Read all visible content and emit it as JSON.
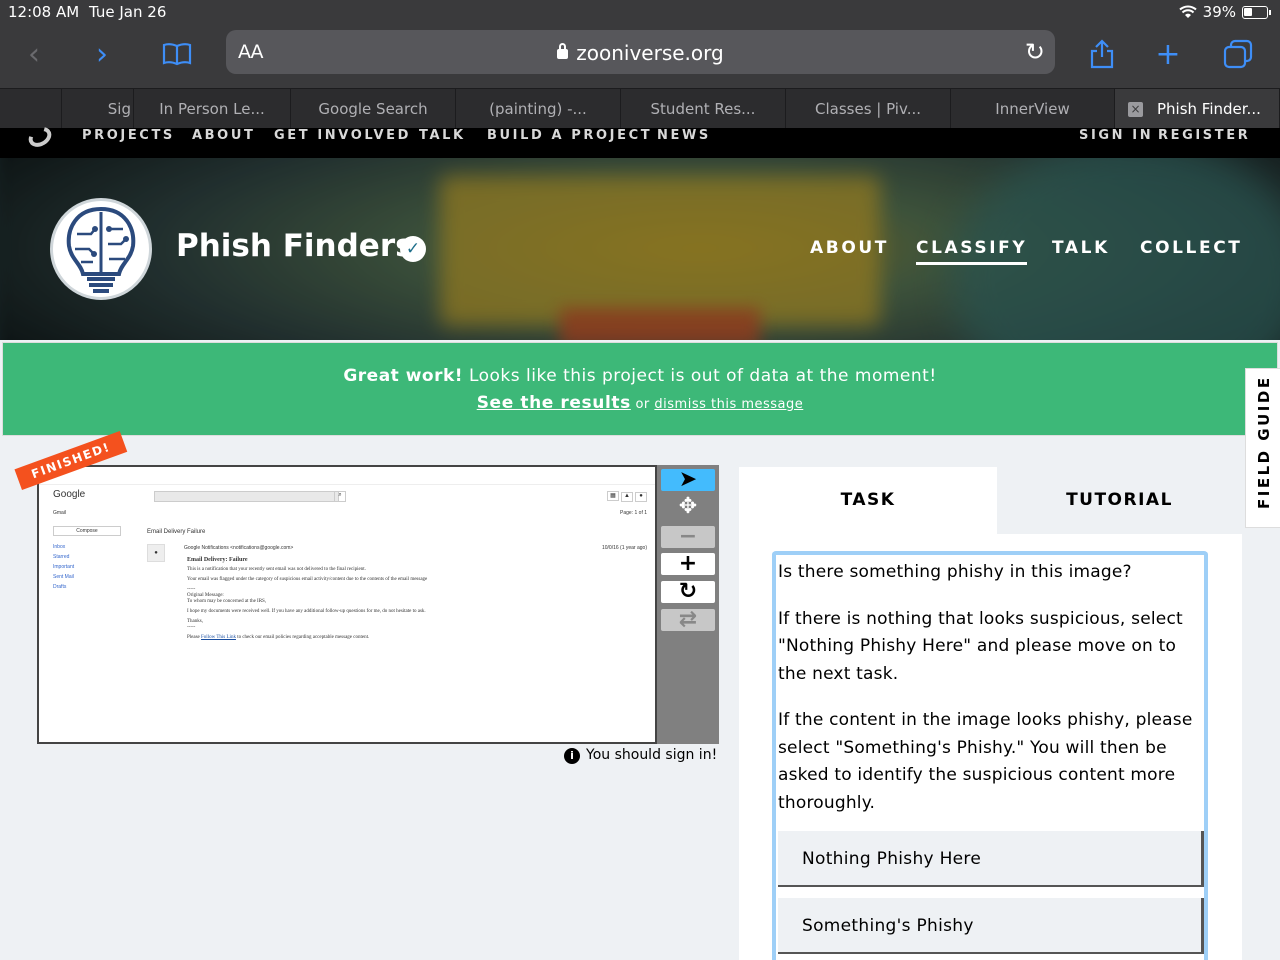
{
  "statusbar": {
    "time": "12:08 AM",
    "date": "Tue Jan 26",
    "battery": "39%"
  },
  "browser": {
    "aa_label": "AA",
    "url": "zooniverse.org",
    "tabs": [
      "Sig",
      "In Person Le...",
      "Google Search",
      "(painting) -...",
      "Student Res...",
      "Classes | Piv...",
      "InnerView",
      "Phish Finder..."
    ]
  },
  "site_nav": {
    "left": [
      "PROJECTS",
      "ABOUT",
      "GET INVOLVED",
      "TALK",
      "BUILD A PROJECT",
      "NEWS"
    ],
    "sign_in": "SIGN IN",
    "register": "REGISTER"
  },
  "project": {
    "title": "Phish Finders",
    "nav": [
      "ABOUT",
      "CLASSIFY",
      "TALK",
      "COLLECT"
    ],
    "active_nav": "CLASSIFY"
  },
  "banner": {
    "bold": "Great work!",
    "message": " Looks like this project is out of data at the moment!",
    "results_link": "See the results",
    "or": " or ",
    "dismiss_link": "dismiss this message"
  },
  "field_guide": "FIELD GUIDE",
  "subject": {
    "ribbon": "FINISHED!",
    "email": {
      "logo": "Google",
      "gmail": "Gmail",
      "pager": "Page: 1 of 1",
      "compose": "Compose",
      "folders": [
        "Inbox",
        "Starred",
        "Important",
        "Sent Mail",
        "Drafts"
      ],
      "subject_line": "Email Delivery Failure",
      "from": "Google Notifications <notifications@google.com>",
      "date": "10/0/16 (1 year ago)",
      "heading": "Email Delivery: Failure",
      "p1": "This is a notification that your recently sent email was not delivered to the final recipient.",
      "p2": "Your email was flagged under the category of suspicious email activity/content due to the contents of the email message",
      "p3a": "-----",
      "p3b": "Original Message:",
      "p3c": "To whom may be concerned at the IRS,",
      "p4": "I hope my documents were received well. If you have any additional follow-up questions for me, do not hesitate to ask.",
      "p5a": "Thanks,",
      "p5b": "-----",
      "p6a": "Please ",
      "p6link": "Follow This Link",
      "p6b": " to check our email policies regarding acceptable message content."
    },
    "sign_in_note": "You should sign in!"
  },
  "task_panel": {
    "tabs": [
      "TASK",
      "TUTORIAL"
    ],
    "active_tab": "TASK",
    "question": [
      "Is there something phishy in this image?",
      "If there is nothing that looks suspicious, select \"Nothing Phishy Here\" and please move on to the next task.",
      "If the content in the image looks phishy, please select \"Something's Phishy.\" You will then be asked to identify the suspicious content more thoroughly."
    ],
    "answers": [
      "Nothing Phishy Here",
      "Something's Phishy"
    ]
  },
  "colors": {
    "banner_green": "#3db878",
    "active_tool_blue": "#43bbfd",
    "task_border": "#9ecff7",
    "safari_blue": "#3e8ef7",
    "ribbon_orange": "#f4511e"
  }
}
